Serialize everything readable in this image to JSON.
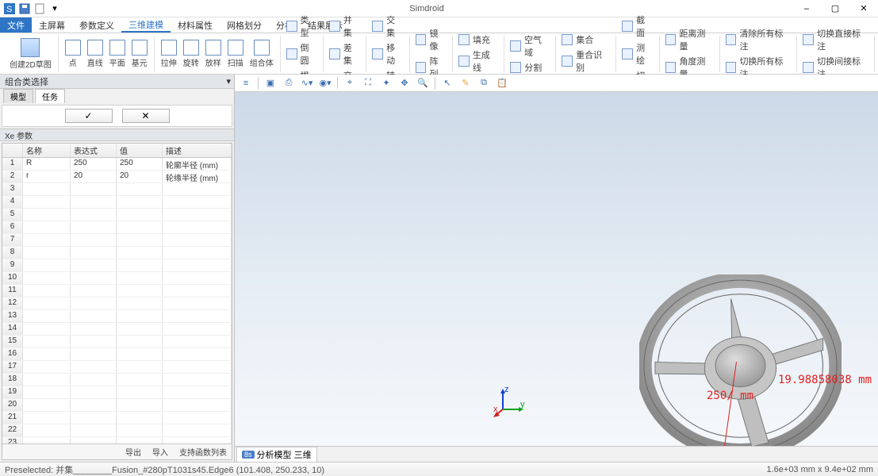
{
  "app": {
    "title": "Simdroid"
  },
  "qat": {
    "i1": "app-icon",
    "i2": "save",
    "i3": "new",
    "i4": "undo"
  },
  "window": {
    "min": "–",
    "max": "▢",
    "close": "✕"
  },
  "menu": {
    "file": "文件",
    "items": [
      "主屏幕",
      "参数定义",
      "三维建模",
      "材料属性",
      "网格划分",
      "分析",
      "结果展示"
    ],
    "active_index": 2
  },
  "ribbon": {
    "g1": {
      "sketch2d": "创建2D草图"
    },
    "g2": {
      "point": "点",
      "line": "直线",
      "plane": "平面",
      "prim": "基元"
    },
    "g3": {
      "extrude": "拉伸",
      "revolve": "旋转",
      "sweep": "放样",
      "loft": "扫描",
      "compound": "组合体"
    },
    "g4": {
      "a": "类型",
      "b": "倒圆",
      "c": "拔模"
    },
    "g5": {
      "a": "并集",
      "b": "差集",
      "c": "交集"
    },
    "g6": {
      "a": "交集",
      "b": "移动",
      "c": "转动"
    },
    "g7": {
      "a": "镜像",
      "b": "阵列"
    },
    "g8": {
      "a": "填充",
      "b": "生成线"
    },
    "g9": {
      "a": "空气域",
      "b": "分割"
    },
    "g10": {
      "a": "集合",
      "b": "重合识别"
    },
    "g11": {
      "a": "截面",
      "b": "测绘",
      "c": "切面"
    },
    "g12": {
      "a": "距离测量",
      "b": "角度测量"
    },
    "g13": {
      "a": "清除所有标注",
      "b": "切换所有标注"
    },
    "g14": {
      "a": "切换直接标注",
      "b": "切换间接标注"
    }
  },
  "left": {
    "panel_title": "组合类选择",
    "tabs": [
      "模型",
      "任务"
    ],
    "active_tab": 1,
    "sub_title": "Xe 参数",
    "ok": "✓",
    "cancel": "✕",
    "cols": [
      "",
      "名称",
      "表达式",
      "值",
      "描述"
    ],
    "rows": [
      {
        "idx": "1",
        "name": "R",
        "expr": "250",
        "val": "250",
        "desc": "轮廓半径 (mm)"
      },
      {
        "idx": "2",
        "name": "r",
        "expr": "20",
        "val": "20",
        "desc": "轮缘半径 (mm)"
      }
    ],
    "empty_rows": 21,
    "footer": {
      "export": "导出",
      "import": "导入",
      "support": "支持函数列表"
    }
  },
  "canvas": {
    "dim1": "250/ mm",
    "dim2": "19.98858038 mm"
  },
  "view_tabs": {
    "badge": "8s",
    "label": "分析模型 三维"
  },
  "status": {
    "left": "Preselected: 并集________Fusion_#280pT1031s45.Edge6 (101.408, 250.233, 10)",
    "right": "1.6e+03 mm x 9.4e+02 mm"
  },
  "chart_data": null
}
